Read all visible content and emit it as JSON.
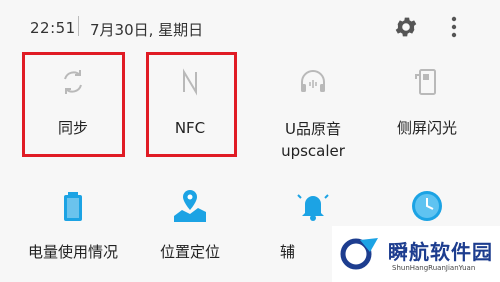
{
  "status": {
    "time": "22:51",
    "date": "7月30日, 星期日"
  },
  "tiles": [
    {
      "label": "同步",
      "icon": "sync-icon"
    },
    {
      "label": "NFC",
      "icon": "nfc-icon"
    },
    {
      "label": "U品原音\nupscaler",
      "icon": "headphones-icon"
    },
    {
      "label": "侧屏闪光",
      "icon": "edge-flash-icon"
    },
    {
      "label": "电量使用情况",
      "icon": "battery-icon"
    },
    {
      "label": "位置定位",
      "icon": "location-map-icon"
    },
    {
      "label": "辅",
      "icon": "bell-icon"
    },
    {
      "label": "",
      "icon": "clock-icon"
    }
  ],
  "watermark": {
    "cn": "瞬航软件园",
    "en": "ShunHangRuanJianYuan"
  },
  "colors": {
    "accent": "#1ca3e4",
    "highlight": "#e01b24",
    "inactive": "#b9b9b9"
  }
}
